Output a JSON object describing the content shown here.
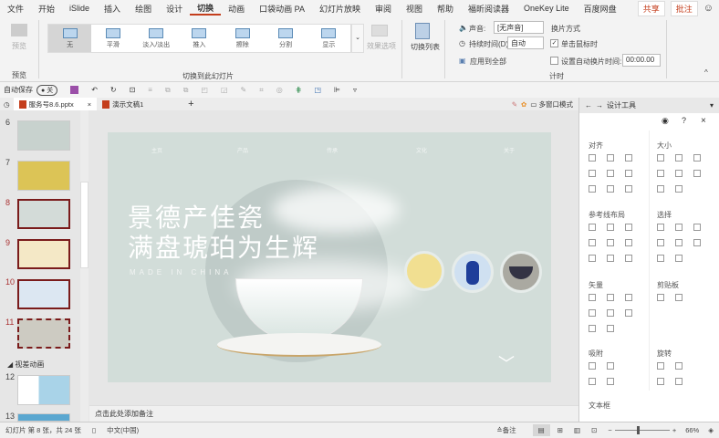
{
  "menu": {
    "items": [
      "文件",
      "开始",
      "iSlide",
      "插入",
      "绘图",
      "设计",
      "切换",
      "动画",
      "口袋动画 PA",
      "幻灯片放映",
      "审阅",
      "视图",
      "帮助",
      "福昕阅读器",
      "OneKey Lite",
      "百度网盘"
    ],
    "active": 6,
    "share": "共享",
    "comment": "批注"
  },
  "ribbon": {
    "preview": "预览",
    "preview_group": "预览",
    "transitions": [
      "无",
      "平滑",
      "淡入/淡出",
      "推入",
      "擦除",
      "分割",
      "显示"
    ],
    "transition_group": "切换到此幻灯片",
    "effect_options": "效果选项",
    "transition_list": "切换列表",
    "sound_label": "声音:",
    "sound_value": "[无声音]",
    "duration_label": "持续时间(D):",
    "duration_value": "自动",
    "apply_all": "应用到全部",
    "advance_title": "换片方式",
    "on_click": "单击鼠标时",
    "on_click_checked": true,
    "auto_after": "设置自动换片时间:",
    "auto_after_checked": false,
    "auto_time": "00:00.00",
    "timing_group": "计时"
  },
  "qat": {
    "autosave": "自动保存",
    "autosave_state": "关"
  },
  "tabs": [
    {
      "label": "服务号8.6.pptx"
    },
    {
      "label": "演示文稿1"
    }
  ],
  "tab_extra": {
    "multiwindow": "多窗口模式"
  },
  "thumbnails": [
    {
      "num": "6"
    },
    {
      "num": "7"
    },
    {
      "num": "8"
    },
    {
      "num": "9"
    },
    {
      "num": "10"
    },
    {
      "num": "11"
    },
    {
      "num": "12"
    },
    {
      "num": "13"
    }
  ],
  "section_label": "视差动画",
  "slide": {
    "nav": [
      "主页",
      "产品",
      "传承",
      "文化",
      "关于"
    ],
    "title1": "景德产佳瓷",
    "title2": "满盘琥珀为生辉",
    "subtitle": "MADE IN CHINA"
  },
  "notes_placeholder": "点击此处添加备注",
  "panel": {
    "title": "设计工具",
    "sections": [
      "对齐",
      "大小",
      "参考线布局",
      "选择",
      "矢量",
      "剪贴板",
      "吸附",
      "旋转",
      "文本框"
    ]
  },
  "status": {
    "slide_info": "幻灯片 第 8 张，共 24 张",
    "language": "中文(中国)",
    "notes": "备注",
    "zoom": "66%"
  }
}
